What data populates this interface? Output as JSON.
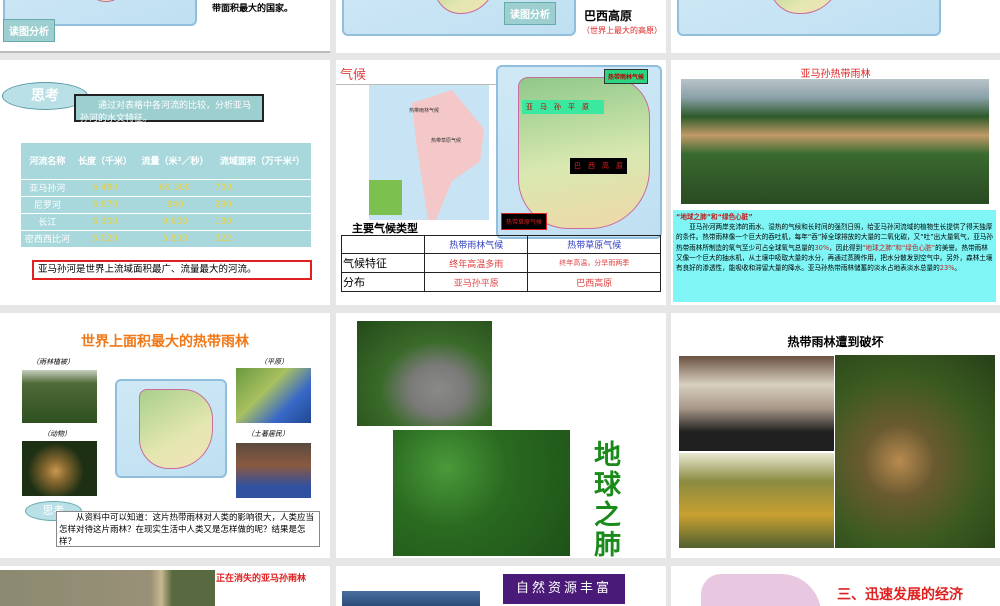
{
  "row1": {
    "s1": {
      "text": "带面积最大的国家。",
      "tag": "读图分析"
    },
    "s2": {
      "tag": "读图分析",
      "title": "巴西高原",
      "note": "（世界上最大的高原）"
    },
    "s3": {}
  },
  "river_slide": {
    "cloud": "思考",
    "prompt": "通过对表格中各河流的比较，分析亚马孙河的水文特征。",
    "headers": [
      "河流名称",
      "长度（千米）",
      "流量（米³／秒）",
      "流域面积（万千米²）"
    ],
    "rows": [
      [
        "亚马孙河",
        "6 480",
        "69 300",
        "700"
      ],
      [
        "尼罗河",
        "6 670",
        "840",
        "290"
      ],
      [
        "长江",
        "6 300",
        "9 600",
        "180"
      ],
      [
        "密西西比河",
        "6 020",
        "5 800",
        "322"
      ]
    ],
    "conclusion": "亚马孙河是世界上流域面积最广、流量最大的河流。"
  },
  "climate_slide": {
    "title": "气候",
    "map_labels": [
      "热带雨林气候",
      "热带草原气候"
    ],
    "callout_rainforest": "热带雨林气候",
    "plain": "亚　马　孙　平　原",
    "plateau": "巴　西　高　原",
    "callout_savanna": "热带草原气候",
    "table_title": "主要气候类型",
    "cols": [
      "热带雨林气候",
      "热带草原气候"
    ],
    "rows": [
      {
        "label": "气候特征",
        "a": "终年高温多雨",
        "b": "终年高温，分旱雨两季"
      },
      {
        "label": "分布",
        "a": "亚马孙平原",
        "b": "巴西高原"
      }
    ]
  },
  "amazon_slide": {
    "title": "亚马孙热带雨林",
    "heading": "“地球之肺”和“绿色心脏”",
    "p1": "亚马孙河两岸充沛的雨水、湿热的气候和长时间的强烈日照，给亚马孙河流域的植物生长提供了得天独厚的条件。热带雨林像一个巨大的吞吐机，每年“吞”掉全球排放的大量的二氧化碳，又“吐”出大量氧气，亚马孙热带雨林所制造的氧气至少可占全球氧气总量的",
    "pct1": "30%",
    "p2": "，因此得到",
    "hl": "“地球之肺”和“绿色心脏”",
    "p3": "的美誉。热带雨林又像一个巨大的抽水机，从土壤中吸取大量的水分，再通过蒸腾作用，把水分散发到空气中。另外，森林土壤有良好的渗透性，能吸收和滞留大量的降水。亚马孙热带雨林储蓄的淡水占地表淡水总量的",
    "pct2": "23%",
    "p4": "。"
  },
  "largest_slide": {
    "title": "世界上面积最大的热带雨林",
    "captions": [
      "（雨林植被）",
      "（平原）",
      "（动物）",
      "（土著居民）"
    ],
    "cloud": "思考",
    "text": "从资料中可以知道：这片热带雨林对人类的影响很大，人类应当怎样对待这片雨林？在现实生活中人类又是怎样做的呢？结果是怎样？"
  },
  "lung_slide": {
    "text": "地球之肺"
  },
  "destroy_slide": {
    "title": "热带雨林遭到破坏"
  },
  "row4": {
    "s1": "正在消失的亚马孙雨林",
    "s2": "自然资源丰富",
    "s3": "三、迅速发展的经济"
  },
  "colors": {
    "red": "#e02020",
    "orange": "#f07818",
    "green": "#1a8a1a",
    "teal": "#a8d8dc",
    "cyan": "#7ff5f5"
  }
}
